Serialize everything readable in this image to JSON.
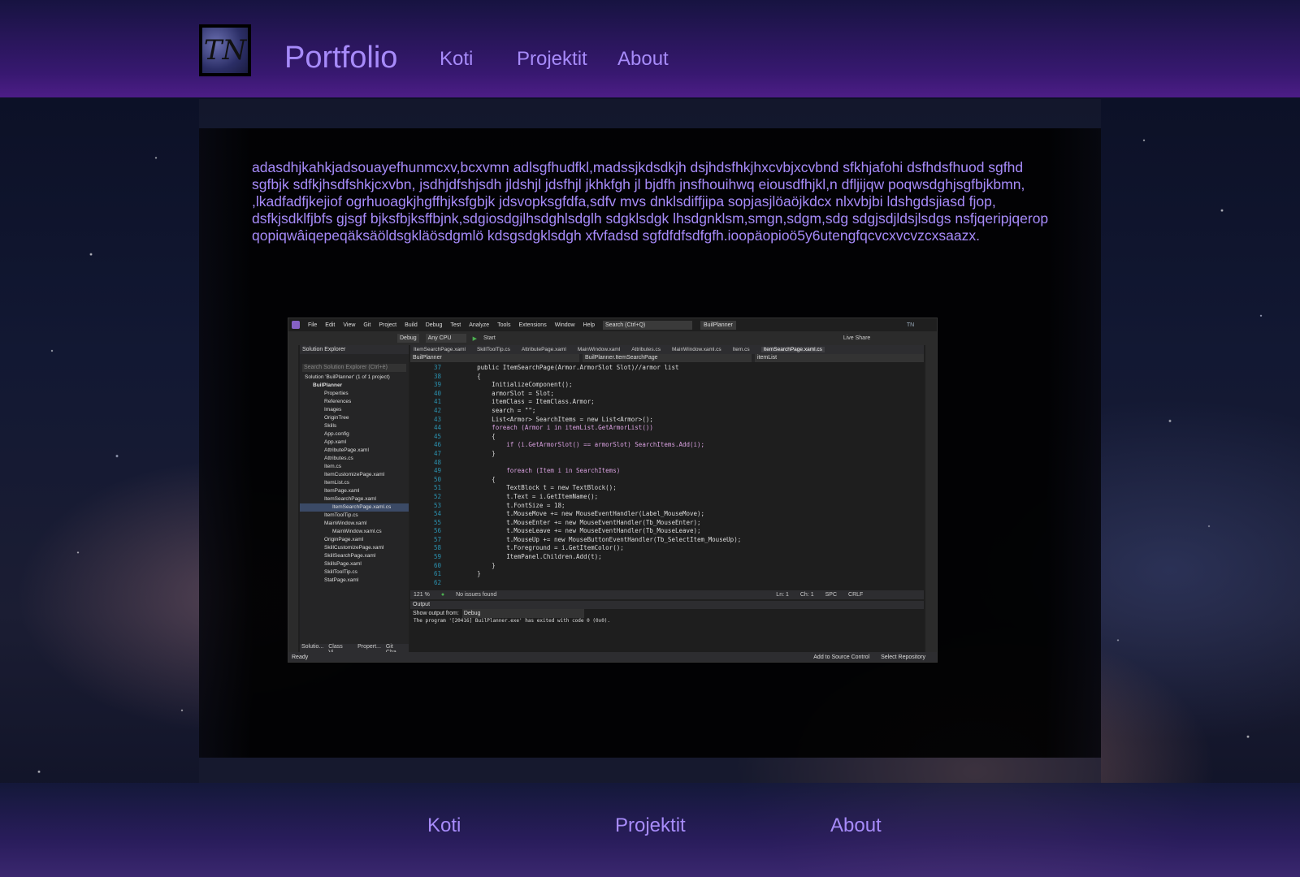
{
  "header": {
    "logo_text": "TN",
    "title": "Portfolio",
    "nav": [
      "Koti",
      "Projektit",
      "About"
    ]
  },
  "main": {
    "paragraph": "adasdhjkahkjadsouayefhunmcxv,bcxvmn adlsgfhudfkl,madssjkdsdkjh dsjhdsfhkjhxcvbjxcvbnd sfkhjafohi dsfhdsfhuod sgfhd sgfbjk sdfkjhsdfshkjcxvbn, jsdhjdfshjsdh jldshjl jdsfhjl jkhkfgh jl bjdfh jnsfhouihwq eiousdfhjkl,n dfljijqw poqwsdghjsgfbjkbmn, ,lkadfadfjkejiof ogrhuoagkjhgffhjksfgbjk jdsvopksgfdfa,sdfv mvs dnklsdiffjipa sopjasjlöaöjkdcx nlxvbjbi ldshgdsjiasd fjop, dsfkjsdklfjbfs gjsgf bjksfbjksffbjnk,sdgiosdgjlhsdghlsdglh sdgklsdgk lhsdgnklsm,smgn,sdgm,sdg sdgjsdjldsjlsdgs nsfjqeripjqerop qopiqwâiqepeqäksäöldsgkläösdgmlö kdsgsdgklsdgh xfvfadsd sgfdfdfsdfgfh.ioopäopioö5y6utengfqcvcxvcvzcxsaazx."
  },
  "screenshot": {
    "menu": [
      "File",
      "Edit",
      "View",
      "Git",
      "Project",
      "Build",
      "Debug",
      "Test",
      "Analyze",
      "Tools",
      "Extensions",
      "Window",
      "Help"
    ],
    "search_placeholder": "Search (Ctrl+Q)",
    "project_badge": "BuilPlanner",
    "user_badge": "TN",
    "live_share": "Live Share",
    "config": "Debug",
    "platform": "Any CPU",
    "start": "Start",
    "solution_explorer_title": "Solution Explorer",
    "solution_search": "Search Solution Explorer (Ctrl+è)",
    "solution_items": [
      "Solution 'BuilPlanner' (1 of 1 project)",
      "BuilPlanner",
      "Properties",
      "References",
      "Images",
      "OriginTree",
      "Skills",
      "App.config",
      "App.xaml",
      "AttributePage.xaml",
      "Attributes.cs",
      "Item.cs",
      "ItemCustomizePage.xaml",
      "ItemList.cs",
      "ItemPage.xaml",
      "ItemSearchPage.xaml",
      "ItemSearchPage.xaml.cs",
      "ItemToolTip.cs",
      "MainWindow.xaml",
      "MainWindow.xaml.cs",
      "OriginPage.xaml",
      "SkillCustomizePage.xaml",
      "SkillSearchPage.xaml",
      "SkillsPage.xaml",
      "SkillToolTip.cs",
      "StatPage.xaml"
    ],
    "solution_tabs": [
      "Solutio...",
      "Class Vi...",
      "Propert...",
      "Git Cha..."
    ],
    "editor_tabs": [
      "ItemSearchPage.xaml",
      "SkillToolTip.cs",
      "AttributePage.xaml",
      "MainWindow.xaml",
      "Attributes.cs",
      "MainWindow.xaml.cs",
      "Item.cs",
      "ItemSearchPage.xaml.cs"
    ],
    "nav_bar": [
      "BuilPlanner",
      "BuilPlanner.ItemSearchPage",
      "itemList"
    ],
    "code_lines": [
      {
        "n": "37",
        "t": "        public ItemSearchPage(Armor.ArmorSlot Slot)//armor list"
      },
      {
        "n": "38",
        "t": "        {"
      },
      {
        "n": "39",
        "t": "            InitializeComponent();"
      },
      {
        "n": "40",
        "t": "            armorSlot = Slot;"
      },
      {
        "n": "41",
        "t": "            itemClass = ItemClass.Armor;"
      },
      {
        "n": "42",
        "t": "            search = \"\";"
      },
      {
        "n": "43",
        "t": "            List<Armor> SearchItems = new List<Armor>();"
      },
      {
        "n": "44",
        "t": "            foreach (Armor i in itemList.GetArmorList())"
      },
      {
        "n": "45",
        "t": "            {"
      },
      {
        "n": "46",
        "t": "                if (i.GetArmorSlot() == armorSlot) SearchItems.Add(i);"
      },
      {
        "n": "47",
        "t": "            }"
      },
      {
        "n": "48",
        "t": ""
      },
      {
        "n": "49",
        "t": "                foreach (Item i in SearchItems)"
      },
      {
        "n": "50",
        "t": "            {"
      },
      {
        "n": "51",
        "t": "                TextBlock t = new TextBlock();"
      },
      {
        "n": "52",
        "t": "                t.Text = i.GetItemName();"
      },
      {
        "n": "53",
        "t": "                t.FontSize = 18;"
      },
      {
        "n": "54",
        "t": "                t.MouseMove += new MouseEventHandler(Label_MouseMove);"
      },
      {
        "n": "55",
        "t": "                t.MouseEnter += new MouseEventHandler(Tb_MouseEnter);"
      },
      {
        "n": "56",
        "t": "                t.MouseLeave += new MouseEventHandler(Tb_MouseLeave);"
      },
      {
        "n": "57",
        "t": "                t.MouseUp += new MouseButtonEventHandler(Tb_SelectItem_MouseUp);"
      },
      {
        "n": "58",
        "t": "                t.Foreground = i.GetItemColor();"
      },
      {
        "n": "59",
        "t": "                ItemPanel.Children.Add(t);"
      },
      {
        "n": "60",
        "t": "            }"
      },
      {
        "n": "61",
        "t": "        }"
      },
      {
        "n": "62",
        "t": ""
      }
    ],
    "editor_status": [
      "121 %",
      "No issues found",
      "Ln: 1",
      "Ch: 1",
      "SPC",
      "CRLF"
    ],
    "output_title": "Output",
    "output_from_label": "Show output from:",
    "output_from_value": "Debug",
    "output_text": "The program '[20416] BuilPlanner.exe' has exited with code 0 (0x0).",
    "status_ready": "Ready",
    "status_source_control": "Add to Source Control",
    "status_repo": "Select Repository"
  },
  "footer": {
    "nav": [
      "Koti",
      "Projektit",
      "About"
    ]
  },
  "colors": {
    "accent": "#a78bfa",
    "header_bg": "#3c1f78"
  }
}
